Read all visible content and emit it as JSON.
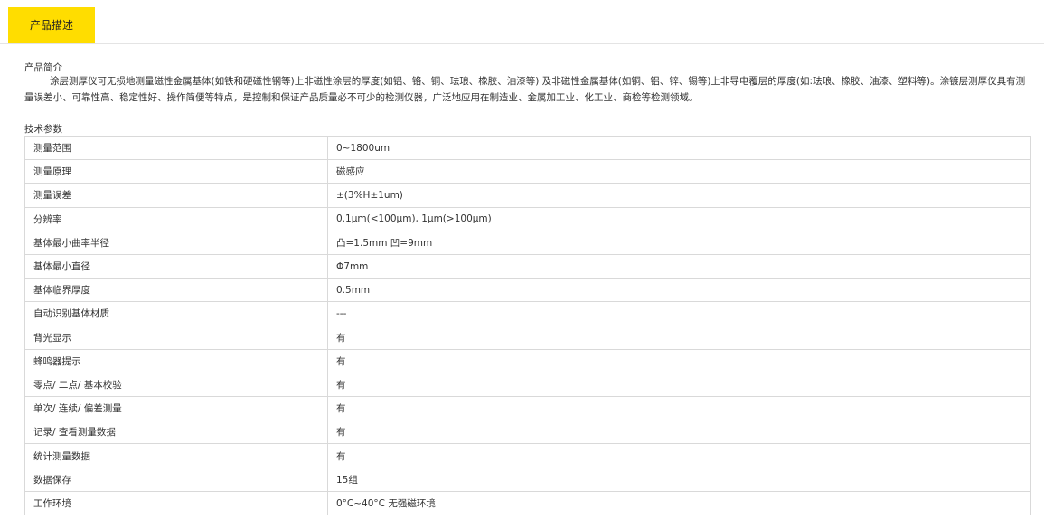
{
  "tabs": [
    {
      "label": "产品描述",
      "active": true
    }
  ],
  "intro": {
    "heading": "产品简介",
    "text": "涂层测厚仪可无损地测量磁性金属基体(如铁和硬磁性钢等)上非磁性涂层的厚度(如铝、铬、铜、珐琅、橡胶、油漆等) 及非磁性金属基体(如铜、铝、锌、锡等)上非导电覆层的厚度(如:珐琅、橡胶、油漆、塑料等)。涂镀层测厚仪具有测量误差小、可靠性高、稳定性好、操作简便等特点，是控制和保证产品质量必不可少的检测仪器，广泛地应用在制造业、金属加工业、化工业、商检等检测领域。"
  },
  "specs": {
    "heading": "技术参数",
    "rows": [
      {
        "name": "测量范围",
        "value": "0~1800um"
      },
      {
        "name": "测量原理",
        "value": "磁感应"
      },
      {
        "name": "测量误差",
        "value": "±(3%H±1um)"
      },
      {
        "name": "分辨率",
        "value": "0.1μm(<100μm), 1μm(>100μm)"
      },
      {
        "name": "基体最小曲率半径",
        "value": "凸=1.5mm 凹=9mm"
      },
      {
        "name": "基体最小直径",
        "value": "Φ7mm"
      },
      {
        "name": "基体临界厚度",
        "value": "0.5mm"
      },
      {
        "name": "自动识别基体材质",
        "value": "---"
      },
      {
        "name": "背光显示",
        "value": "有"
      },
      {
        "name": "蜂鸣器提示",
        "value": "有"
      },
      {
        "name": "零点/ 二点/ 基本校验",
        "value": "有"
      },
      {
        "name": "单次/ 连续/ 偏差测量",
        "value": "有"
      },
      {
        "name": "记录/ 查看测量数据",
        "value": "有"
      },
      {
        "name": "统计测量数据",
        "value": "有"
      },
      {
        "name": "数据保存",
        "value": "15组"
      },
      {
        "name": "工作环境",
        "value": "0°C~40°C 无强磁环境"
      }
    ]
  },
  "colors": {
    "tab_active_bg": "#ffdd00",
    "border": "#d9d9d9",
    "text": "#333333"
  }
}
